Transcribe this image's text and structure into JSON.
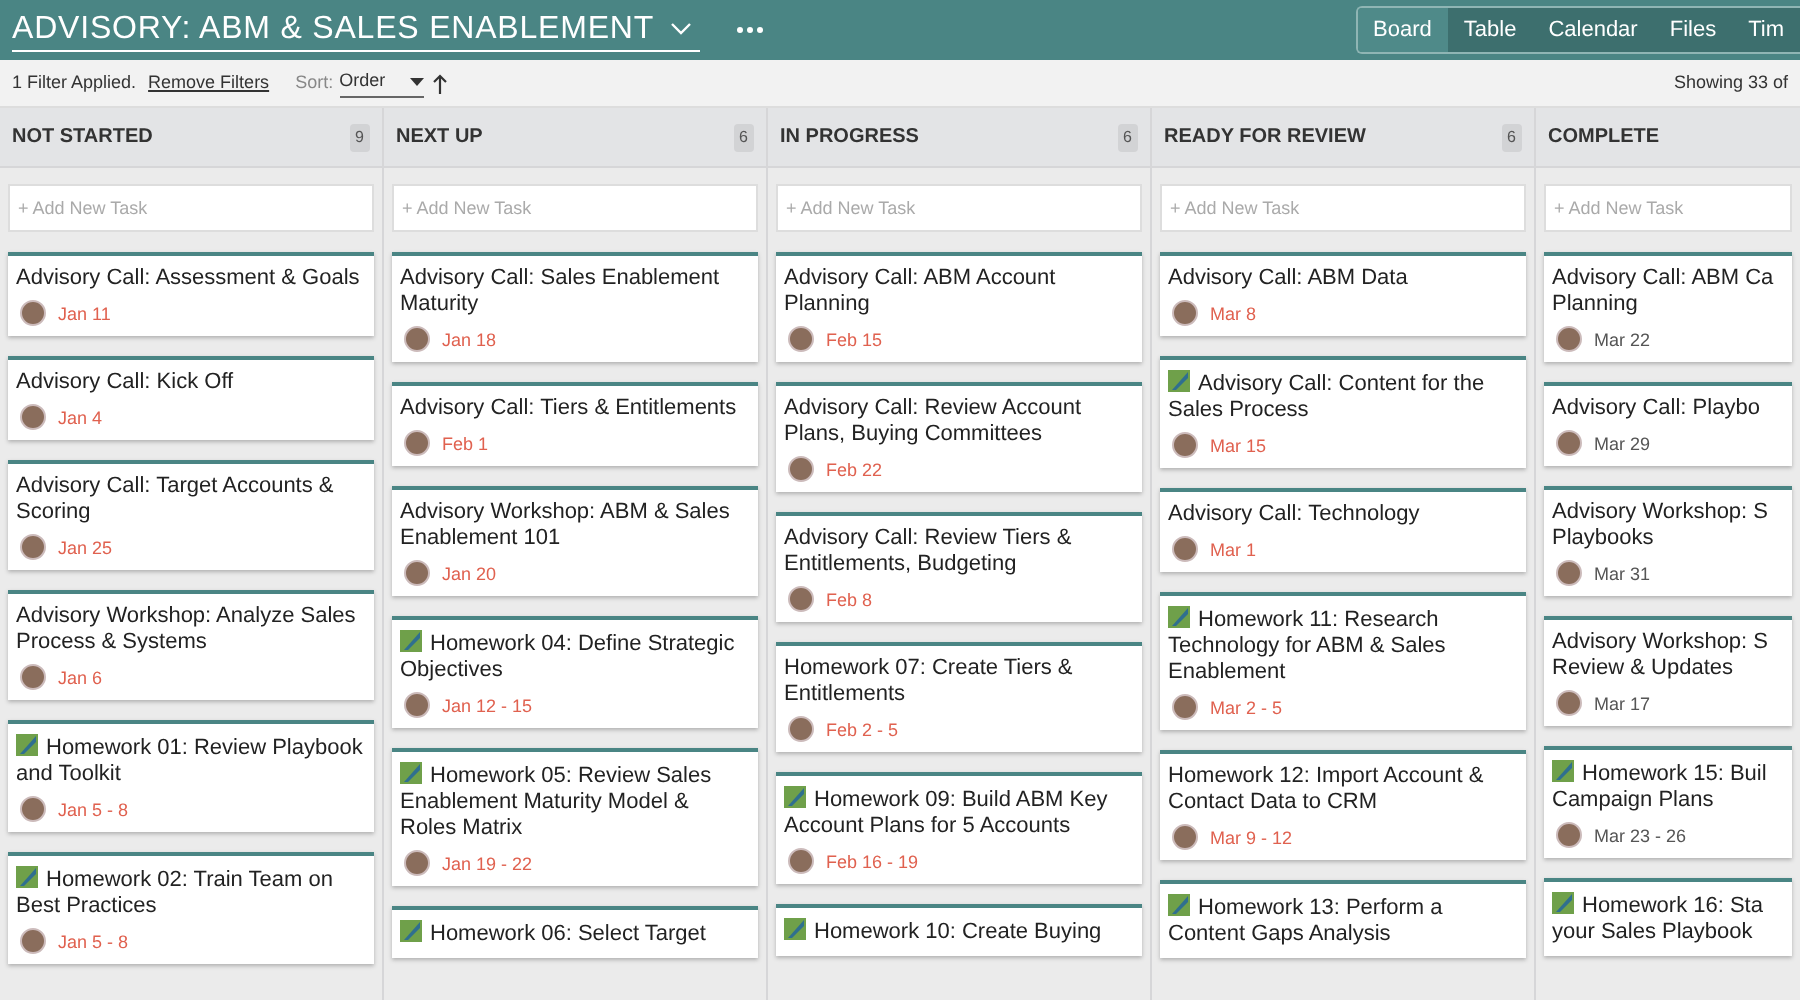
{
  "header": {
    "title": "ADVISORY: ABM & SALES ENABLEMENT",
    "views": [
      {
        "label": "Board",
        "selected": true
      },
      {
        "label": "Table",
        "selected": false
      },
      {
        "label": "Calendar",
        "selected": false
      },
      {
        "label": "Files",
        "selected": false
      },
      {
        "label": "Tim",
        "selected": false
      }
    ]
  },
  "filter_bar": {
    "filter_text": "1 Filter Applied.",
    "remove_link": "Remove Filters",
    "sort_label": "Sort:",
    "sort_value": "Order",
    "showing": "Showing 33 of"
  },
  "columns": [
    {
      "name": "NOT STARTED",
      "count": "9",
      "add_placeholder": "+ Add New Task",
      "cards": [
        {
          "title": "Advisory Call: Assessment & Goals",
          "date": "Jan 11",
          "homework": false,
          "overdue": true
        },
        {
          "title": "Advisory Call: Kick Off",
          "date": "Jan 4",
          "homework": false,
          "overdue": true
        },
        {
          "title": "Advisory Call: Target Accounts & Scoring",
          "date": "Jan 25",
          "homework": false,
          "overdue": true
        },
        {
          "title": "Advisory Workshop: Analyze Sales Process & Systems",
          "date": "Jan 6",
          "homework": false,
          "overdue": true
        },
        {
          "title": "Homework 01: Review Playbook and Toolkit",
          "date": "Jan 5 - 8",
          "homework": true,
          "overdue": true
        },
        {
          "title": "Homework 02: Train Team on Best Practices",
          "date": "Jan 5 - 8",
          "homework": true,
          "overdue": true
        }
      ]
    },
    {
      "name": "NEXT UP",
      "count": "6",
      "add_placeholder": "+ Add New Task",
      "cards": [
        {
          "title": "Advisory Call: Sales Enablement Maturity",
          "date": "Jan 18",
          "homework": false,
          "overdue": true
        },
        {
          "title": "Advisory Call: Tiers & Entitlements",
          "date": "Feb 1",
          "homework": false,
          "overdue": true
        },
        {
          "title": "Advisory Workshop: ABM & Sales Enablement 101",
          "date": "Jan 20",
          "homework": false,
          "overdue": true
        },
        {
          "title": "Homework 04: Define Strategic Objectives",
          "date": "Jan 12 - 15",
          "homework": true,
          "overdue": true
        },
        {
          "title": "Homework 05: Review Sales Enablement Maturity Model & Roles Matrix",
          "date": "Jan 19 - 22",
          "homework": true,
          "overdue": true
        },
        {
          "title": "Homework 06: Select Target",
          "homework": true
        }
      ]
    },
    {
      "name": "IN PROGRESS",
      "count": "6",
      "add_placeholder": "+ Add New Task",
      "cards": [
        {
          "title": "Advisory Call: ABM Account Planning",
          "date": "Feb 15",
          "homework": false,
          "overdue": true
        },
        {
          "title": "Advisory Call: Review Account Plans, Buying Committees",
          "date": "Feb 22",
          "homework": false,
          "overdue": true
        },
        {
          "title": "Advisory Call: Review Tiers & Entitlements, Budgeting",
          "date": "Feb 8",
          "homework": false,
          "overdue": true
        },
        {
          "title": "Homework 07: Create Tiers & Entitlements",
          "date": "Feb 2 - 5",
          "homework": false,
          "overdue": true
        },
        {
          "title": "Homework 09: Build ABM Key Account Plans for 5 Accounts",
          "date": "Feb 16 - 19",
          "homework": true,
          "overdue": true
        },
        {
          "title": "Homework 10: Create Buying",
          "homework": true
        }
      ]
    },
    {
      "name": "READY FOR REVIEW",
      "count": "6",
      "add_placeholder": "+ Add New Task",
      "cards": [
        {
          "title": "Advisory Call: ABM Data",
          "date": "Mar 8",
          "homework": false,
          "overdue": true
        },
        {
          "title": "Advisory Call: Content for the Sales Process",
          "date": "Mar 15",
          "homework": true,
          "overdue": true
        },
        {
          "title": "Advisory Call: Technology",
          "date": "Mar 1",
          "homework": false,
          "overdue": true
        },
        {
          "title": "Homework 11: Research Technology for ABM & Sales Enablement",
          "date": "Mar 2 - 5",
          "homework": true,
          "overdue": true
        },
        {
          "title": "Homework 12: Import Account & Contact Data to CRM",
          "date": "Mar 9 - 12",
          "homework": false,
          "overdue": true
        },
        {
          "title": "Homework 13: Perform a\nContent Gaps Analysis",
          "homework": true
        }
      ]
    },
    {
      "name": "COMPLETE",
      "add_placeholder": "+ Add New Task",
      "cards": [
        {
          "title": "Advisory Call: ABM Ca\nPlanning",
          "date": "Mar 22",
          "homework": false,
          "overdue": false
        },
        {
          "title": "Advisory Call: Playbo",
          "date": "Mar 29",
          "homework": false,
          "overdue": false
        },
        {
          "title": "Advisory Workshop: S\nPlaybooks",
          "date": "Mar 31",
          "homework": false,
          "overdue": false
        },
        {
          "title": "Advisory Workshop: S\nReview & Updates",
          "date": "Mar 17",
          "homework": false,
          "overdue": false
        },
        {
          "title": "Homework 15: Buil\nCampaign Plans",
          "date": "Mar 23 - 26",
          "homework": true,
          "overdue": false
        },
        {
          "title": "Homework 16: Sta\nyour Sales Playbook",
          "homework": true
        }
      ]
    }
  ]
}
